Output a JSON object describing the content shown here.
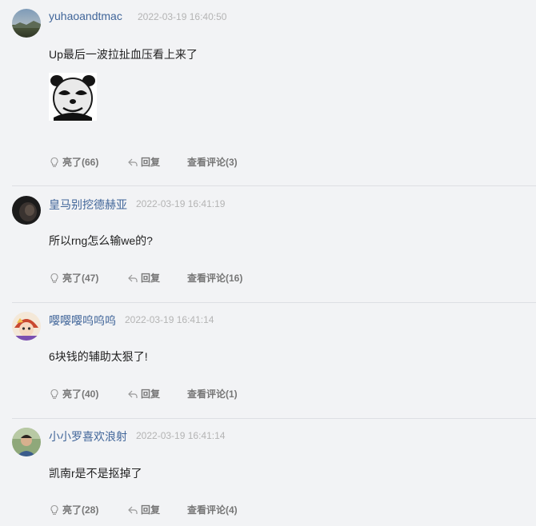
{
  "comments": [
    {
      "username": "yuhaoandtmac",
      "timestamp": "2022-03-19 16:40:50",
      "content": "Up最后一波拉扯血压看上来了",
      "has_sticker": true,
      "like_label": "亮了(66)",
      "reply_label": "回复",
      "view_label": "查看评论(3)"
    },
    {
      "username": "皇马别挖德赫亚",
      "timestamp": "2022-03-19 16:41:19",
      "content": "所以rng怎么输we的?",
      "like_label": "亮了(47)",
      "reply_label": "回复",
      "view_label": "查看评论(16)"
    },
    {
      "username": "嘤嘤嘤呜呜呜",
      "timestamp": "2022-03-19 16:41:14",
      "content": "6块钱的辅助太狠了!",
      "like_label": "亮了(40)",
      "reply_label": "回复",
      "view_label": "查看评论(1)"
    },
    {
      "username": "小小罗喜欢浪射",
      "timestamp": "2022-03-19 16:41:14",
      "content": "凯南r是不是抠掉了",
      "like_label": "亮了(28)",
      "reply_label": "回复",
      "view_label": "查看评论(4)"
    }
  ],
  "colors": {
    "background": "#f2f3f5",
    "username": "#406599",
    "timestamp": "#b4b4b4",
    "action": "#777777",
    "divider": "#dddfe3"
  },
  "icons": {
    "like": "lightbulb-icon",
    "reply": "reply-arrow-icon"
  }
}
